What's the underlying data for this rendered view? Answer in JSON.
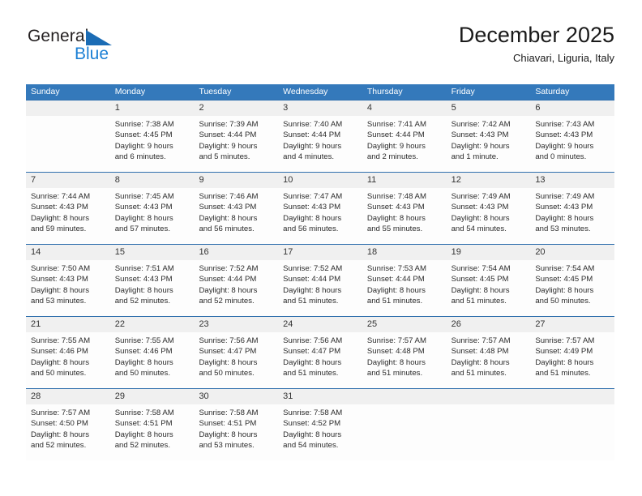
{
  "brand": {
    "name_top": "General",
    "name_bottom": "Blue",
    "triangle_color": "#1b6cb5",
    "blue_text_color": "#1b7fd4"
  },
  "header": {
    "title": "December 2025",
    "subtitle": "Chiavari, Liguria, Italy",
    "header_bg_color": "#3479bb",
    "header_text_color": "#ffffff",
    "row_divider_color": "#2f6fad",
    "daynum_band_color": "#f0f0f0"
  },
  "weekdays": [
    "Sunday",
    "Monday",
    "Tuesday",
    "Wednesday",
    "Thursday",
    "Friday",
    "Saturday"
  ],
  "weeks": [
    {
      "days": [
        {
          "num": "",
          "line1": "",
          "line2": "",
          "line3": "",
          "line4": ""
        },
        {
          "num": "1",
          "line1": "Sunrise: 7:38 AM",
          "line2": "Sunset: 4:45 PM",
          "line3": "Daylight: 9 hours",
          "line4": "and 6 minutes."
        },
        {
          "num": "2",
          "line1": "Sunrise: 7:39 AM",
          "line2": "Sunset: 4:44 PM",
          "line3": "Daylight: 9 hours",
          "line4": "and 5 minutes."
        },
        {
          "num": "3",
          "line1": "Sunrise: 7:40 AM",
          "line2": "Sunset: 4:44 PM",
          "line3": "Daylight: 9 hours",
          "line4": "and 4 minutes."
        },
        {
          "num": "4",
          "line1": "Sunrise: 7:41 AM",
          "line2": "Sunset: 4:44 PM",
          "line3": "Daylight: 9 hours",
          "line4": "and 2 minutes."
        },
        {
          "num": "5",
          "line1": "Sunrise: 7:42 AM",
          "line2": "Sunset: 4:43 PM",
          "line3": "Daylight: 9 hours",
          "line4": "and 1 minute."
        },
        {
          "num": "6",
          "line1": "Sunrise: 7:43 AM",
          "line2": "Sunset: 4:43 PM",
          "line3": "Daylight: 9 hours",
          "line4": "and 0 minutes."
        }
      ]
    },
    {
      "days": [
        {
          "num": "7",
          "line1": "Sunrise: 7:44 AM",
          "line2": "Sunset: 4:43 PM",
          "line3": "Daylight: 8 hours",
          "line4": "and 59 minutes."
        },
        {
          "num": "8",
          "line1": "Sunrise: 7:45 AM",
          "line2": "Sunset: 4:43 PM",
          "line3": "Daylight: 8 hours",
          "line4": "and 57 minutes."
        },
        {
          "num": "9",
          "line1": "Sunrise: 7:46 AM",
          "line2": "Sunset: 4:43 PM",
          "line3": "Daylight: 8 hours",
          "line4": "and 56 minutes."
        },
        {
          "num": "10",
          "line1": "Sunrise: 7:47 AM",
          "line2": "Sunset: 4:43 PM",
          "line3": "Daylight: 8 hours",
          "line4": "and 56 minutes."
        },
        {
          "num": "11",
          "line1": "Sunrise: 7:48 AM",
          "line2": "Sunset: 4:43 PM",
          "line3": "Daylight: 8 hours",
          "line4": "and 55 minutes."
        },
        {
          "num": "12",
          "line1": "Sunrise: 7:49 AM",
          "line2": "Sunset: 4:43 PM",
          "line3": "Daylight: 8 hours",
          "line4": "and 54 minutes."
        },
        {
          "num": "13",
          "line1": "Sunrise: 7:49 AM",
          "line2": "Sunset: 4:43 PM",
          "line3": "Daylight: 8 hours",
          "line4": "and 53 minutes."
        }
      ]
    },
    {
      "days": [
        {
          "num": "14",
          "line1": "Sunrise: 7:50 AM",
          "line2": "Sunset: 4:43 PM",
          "line3": "Daylight: 8 hours",
          "line4": "and 53 minutes."
        },
        {
          "num": "15",
          "line1": "Sunrise: 7:51 AM",
          "line2": "Sunset: 4:43 PM",
          "line3": "Daylight: 8 hours",
          "line4": "and 52 minutes."
        },
        {
          "num": "16",
          "line1": "Sunrise: 7:52 AM",
          "line2": "Sunset: 4:44 PM",
          "line3": "Daylight: 8 hours",
          "line4": "and 52 minutes."
        },
        {
          "num": "17",
          "line1": "Sunrise: 7:52 AM",
          "line2": "Sunset: 4:44 PM",
          "line3": "Daylight: 8 hours",
          "line4": "and 51 minutes."
        },
        {
          "num": "18",
          "line1": "Sunrise: 7:53 AM",
          "line2": "Sunset: 4:44 PM",
          "line3": "Daylight: 8 hours",
          "line4": "and 51 minutes."
        },
        {
          "num": "19",
          "line1": "Sunrise: 7:54 AM",
          "line2": "Sunset: 4:45 PM",
          "line3": "Daylight: 8 hours",
          "line4": "and 51 minutes."
        },
        {
          "num": "20",
          "line1": "Sunrise: 7:54 AM",
          "line2": "Sunset: 4:45 PM",
          "line3": "Daylight: 8 hours",
          "line4": "and 50 minutes."
        }
      ]
    },
    {
      "days": [
        {
          "num": "21",
          "line1": "Sunrise: 7:55 AM",
          "line2": "Sunset: 4:46 PM",
          "line3": "Daylight: 8 hours",
          "line4": "and 50 minutes."
        },
        {
          "num": "22",
          "line1": "Sunrise: 7:55 AM",
          "line2": "Sunset: 4:46 PM",
          "line3": "Daylight: 8 hours",
          "line4": "and 50 minutes."
        },
        {
          "num": "23",
          "line1": "Sunrise: 7:56 AM",
          "line2": "Sunset: 4:47 PM",
          "line3": "Daylight: 8 hours",
          "line4": "and 50 minutes."
        },
        {
          "num": "24",
          "line1": "Sunrise: 7:56 AM",
          "line2": "Sunset: 4:47 PM",
          "line3": "Daylight: 8 hours",
          "line4": "and 51 minutes."
        },
        {
          "num": "25",
          "line1": "Sunrise: 7:57 AM",
          "line2": "Sunset: 4:48 PM",
          "line3": "Daylight: 8 hours",
          "line4": "and 51 minutes."
        },
        {
          "num": "26",
          "line1": "Sunrise: 7:57 AM",
          "line2": "Sunset: 4:48 PM",
          "line3": "Daylight: 8 hours",
          "line4": "and 51 minutes."
        },
        {
          "num": "27",
          "line1": "Sunrise: 7:57 AM",
          "line2": "Sunset: 4:49 PM",
          "line3": "Daylight: 8 hours",
          "line4": "and 51 minutes."
        }
      ]
    },
    {
      "days": [
        {
          "num": "28",
          "line1": "Sunrise: 7:57 AM",
          "line2": "Sunset: 4:50 PM",
          "line3": "Daylight: 8 hours",
          "line4": "and 52 minutes."
        },
        {
          "num": "29",
          "line1": "Sunrise: 7:58 AM",
          "line2": "Sunset: 4:51 PM",
          "line3": "Daylight: 8 hours",
          "line4": "and 52 minutes."
        },
        {
          "num": "30",
          "line1": "Sunrise: 7:58 AM",
          "line2": "Sunset: 4:51 PM",
          "line3": "Daylight: 8 hours",
          "line4": "and 53 minutes."
        },
        {
          "num": "31",
          "line1": "Sunrise: 7:58 AM",
          "line2": "Sunset: 4:52 PM",
          "line3": "Daylight: 8 hours",
          "line4": "and 54 minutes."
        },
        {
          "num": "",
          "line1": "",
          "line2": "",
          "line3": "",
          "line4": ""
        },
        {
          "num": "",
          "line1": "",
          "line2": "",
          "line3": "",
          "line4": ""
        },
        {
          "num": "",
          "line1": "",
          "line2": "",
          "line3": "",
          "line4": ""
        }
      ]
    }
  ]
}
